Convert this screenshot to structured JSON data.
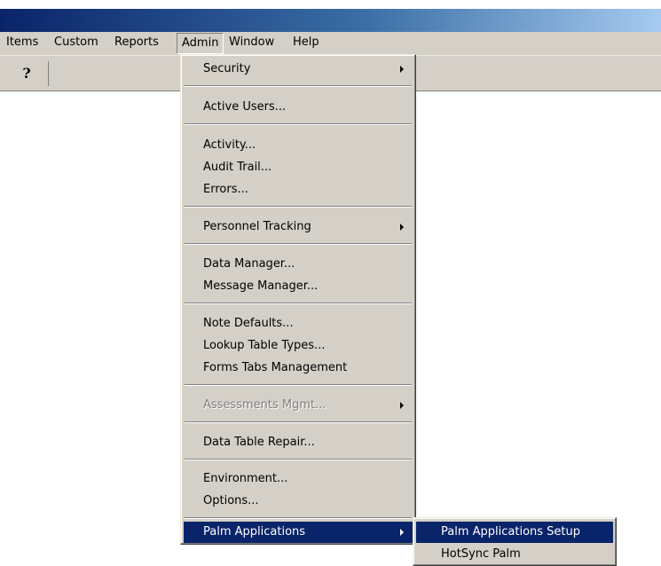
{
  "menubar": {
    "items": [
      "Items",
      "Custom",
      "Reports",
      "Admin",
      "Window",
      "Help"
    ]
  },
  "toolbar": {
    "help_glyph": "?",
    "help_icon": "help-pointer-icon"
  },
  "admin_menu": {
    "security": "Security",
    "active_users": "Active Users...",
    "activity": "Activity...",
    "audit_trail": "Audit Trail...",
    "errors": "Errors...",
    "personnel_tracking": "Personnel Tracking",
    "data_manager": "Data Manager...",
    "message_manager": "Message Manager...",
    "note_defaults": "Note Defaults...",
    "lookup_table_types": "Lookup Table Types...",
    "forms_tabs_management": "Forms Tabs Management",
    "assessments_mgmt": "Assessments Mgmt...",
    "data_table_repair": "Data Table Repair...",
    "environment": "Environment...",
    "options": "Options...",
    "palm_applications": "Palm Applications"
  },
  "palm_submenu": {
    "setup": "Palm Applications Setup",
    "hotsync": "HotSync Palm"
  },
  "colors": {
    "menu_face": "#d4d0c8",
    "highlight": "#0a246a",
    "titlebar_start": "#0a246a",
    "titlebar_end": "#a6caf0"
  }
}
